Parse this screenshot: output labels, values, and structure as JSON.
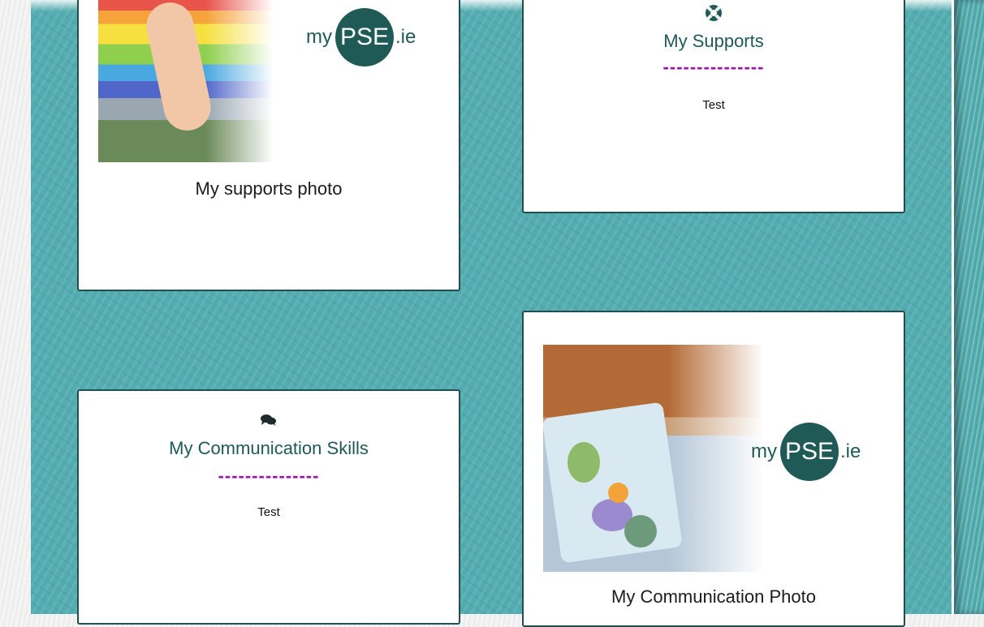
{
  "cards": [
    {
      "type": "photo",
      "caption": "My supports photo",
      "logo": {
        "prefix": "my",
        "center": "PSE",
        "suffix": ".ie"
      }
    },
    {
      "type": "section",
      "icon": "lifebuoy-icon",
      "title": "My Supports",
      "divider": "---------------",
      "text": "Test"
    },
    {
      "type": "section",
      "icon": "comments-icon",
      "title": "My Communication Skills",
      "divider": "---------------",
      "text": "Test"
    },
    {
      "type": "photo",
      "caption": "My Communication Photo",
      "logo": {
        "prefix": "my",
        "center": "PSE",
        "suffix": ".ie"
      }
    }
  ],
  "colors": {
    "background": "#53adb0",
    "card_border": "#1f4f50",
    "title": "#1f5a57",
    "divider": "#9b14a9",
    "logo_circle": "#1f5a57"
  }
}
